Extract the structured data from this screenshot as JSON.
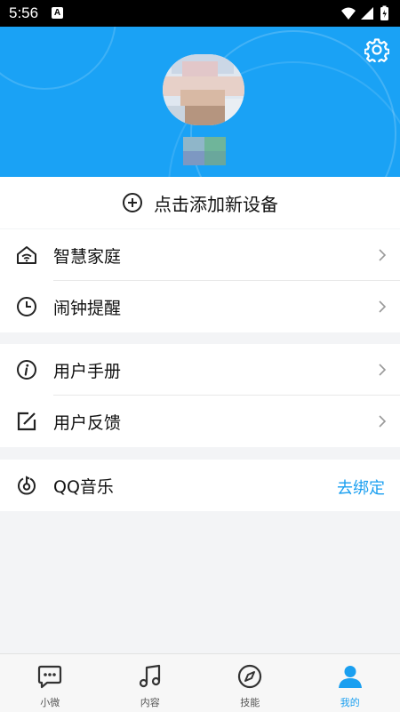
{
  "status_bar": {
    "time": "5:56",
    "notification_icon": "A"
  },
  "header": {
    "settings_icon": "gear-icon"
  },
  "add_device": {
    "label": "点击添加新设备"
  },
  "menu_group_1": [
    {
      "label": "智慧家庭",
      "icon": "home-wifi-icon"
    },
    {
      "label": "闹钟提醒",
      "icon": "clock-icon"
    }
  ],
  "menu_group_2": [
    {
      "label": "用户手册",
      "icon": "info-icon"
    },
    {
      "label": "用户反馈",
      "icon": "edit-icon"
    }
  ],
  "qq_music": {
    "label": "QQ音乐",
    "action": "去绑定"
  },
  "tabs": [
    {
      "label": "小微",
      "icon": "chat-icon"
    },
    {
      "label": "内容",
      "icon": "music-note-icon"
    },
    {
      "label": "技能",
      "icon": "compass-icon"
    },
    {
      "label": "我的",
      "icon": "person-icon"
    }
  ],
  "colors": {
    "accent": "#1aa2f5",
    "link": "#1a9ff0",
    "status_bar": "#000000"
  }
}
